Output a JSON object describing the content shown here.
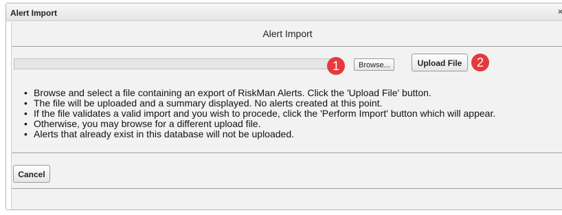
{
  "dialog": {
    "title": "Alert Import",
    "close_glyph": "×",
    "heading": "Alert Import"
  },
  "upload": {
    "browse_label": "Browse...",
    "upload_label": "Upload File",
    "badge_1": "1",
    "badge_2": "2",
    "badge_color": "#e5393b"
  },
  "instructions": [
    "Browse and select a file containing an export of RiskMan Alerts. Click the 'Upload File' button.",
    "The file will be uploaded and a summary displayed. No alerts created at this point.",
    "If the file validates a valid import and you wish to procede, click the 'Perform Import' button which will appear.",
    "Otherwise, you may browse for a different upload file.",
    "Alerts that already exist in this database will not be uploaded."
  ],
  "footer": {
    "cancel_label": "Cancel"
  }
}
